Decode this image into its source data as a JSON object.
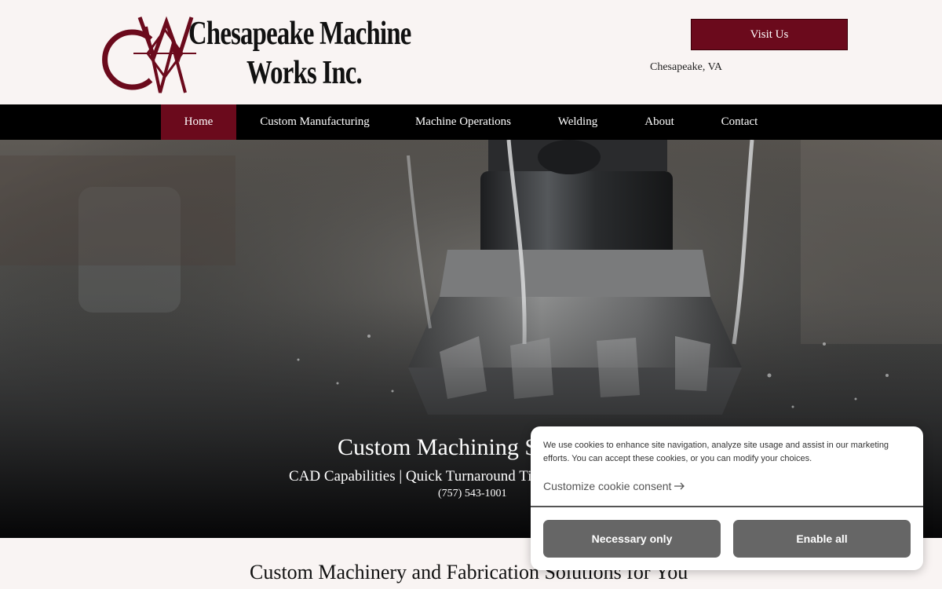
{
  "header": {
    "logo_line1": "Chesapeake Machine",
    "logo_line2": "Works Inc.",
    "visit_label": "Visit Us",
    "location": "Chesapeake, VA"
  },
  "nav": {
    "items": [
      {
        "label": "Home",
        "active": true
      },
      {
        "label": "Custom Manufacturing"
      },
      {
        "label": "Machine Operations"
      },
      {
        "label": "Welding"
      },
      {
        "label": "About"
      },
      {
        "label": "Contact"
      }
    ]
  },
  "hero": {
    "title": "Custom Machining Services",
    "subtitle": "CAD Capabilities | Quick Turnaround Times",
    "phone": "(757) 543-1001"
  },
  "section": {
    "heading": "Custom Machinery and Fabrication Solutions for You"
  },
  "cookie": {
    "text": "We use cookies to enhance site navigation, analyze site usage and assist in our marketing efforts. You can accept these cookies, or you can modify your choices.",
    "customize_label": "Customize cookie consent",
    "necessary_label": "Necessary only",
    "enable_label": "Enable all"
  },
  "colors": {
    "brand": "#6b0a1c",
    "nav_bg": "#000000",
    "page_bg": "#f9f4f3",
    "cookie_button": "#666666"
  },
  "icons": {
    "logo": "cmw-monogram-icon",
    "customize_arrow": "arrow-right-icon"
  }
}
